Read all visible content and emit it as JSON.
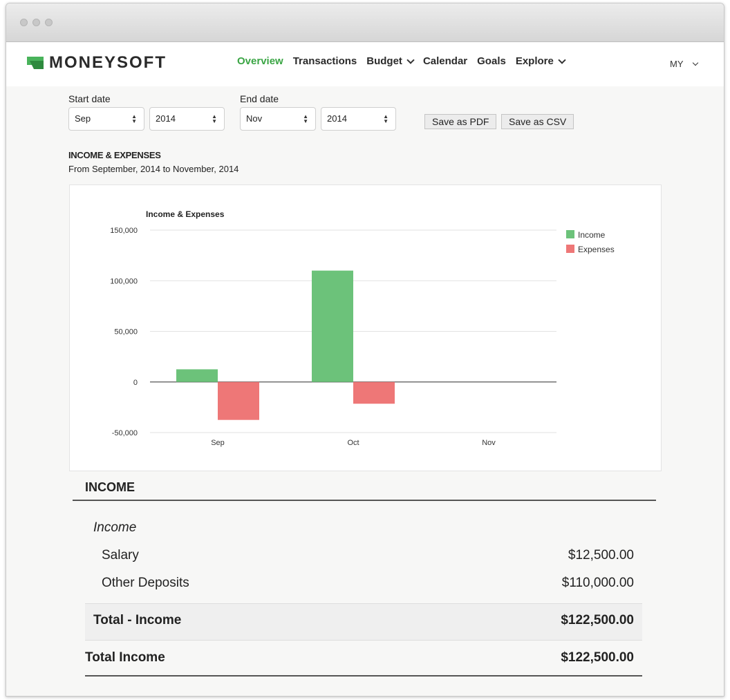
{
  "brand": {
    "name": "MONEYSOFT",
    "logo_color": "#49b35b"
  },
  "nav": {
    "items": [
      {
        "label": "Overview",
        "active": true,
        "dropdown": false
      },
      {
        "label": "Transactions",
        "active": false,
        "dropdown": false
      },
      {
        "label": "Budget",
        "active": false,
        "dropdown": true
      },
      {
        "label": "Calendar",
        "active": false,
        "dropdown": false
      },
      {
        "label": "Goals",
        "active": false,
        "dropdown": false
      },
      {
        "label": "Explore",
        "active": false,
        "dropdown": true
      }
    ],
    "user_label": "MY",
    "accent_color": "#3aa544"
  },
  "filters": {
    "start_label": "Start date",
    "end_label": "End date",
    "start_month": "Sep",
    "start_year": "2014",
    "end_month": "Nov",
    "end_year": "2014",
    "save_pdf": "Save as PDF",
    "save_csv": "Save as CSV"
  },
  "report": {
    "title": "INCOME & EXPENSES",
    "subtitle": "From September, 2014 to November, 2014"
  },
  "chart_data": {
    "type": "bar",
    "title": "Income & Expenses",
    "categories": [
      "Sep",
      "Oct",
      "Nov"
    ],
    "series": [
      {
        "name": "Income",
        "values": [
          12500,
          110000,
          0
        ],
        "color": "#6cc27a"
      },
      {
        "name": "Expenses",
        "values": [
          -37500,
          -21500,
          0
        ],
        "color": "#ee7777"
      }
    ],
    "ylim": [
      -50000,
      150000
    ],
    "yticks": [
      150000,
      100000,
      50000,
      0,
      -50000
    ],
    "ytick_labels": [
      "150,000",
      "100,000",
      "50,000",
      "0",
      "-50,000"
    ],
    "grid": true,
    "legend": "right",
    "xlabel": "",
    "ylabel": ""
  },
  "income_section": {
    "heading": "INCOME",
    "group_heading": "Income",
    "rows": [
      {
        "label": "Salary",
        "value": "$12,500.00"
      },
      {
        "label": "Other Deposits",
        "value": "$110,000.00"
      }
    ],
    "subtotal_label": "Total - Income",
    "subtotal_value": "$122,500.00",
    "total_label": "Total Income",
    "total_value": "$122,500.00"
  }
}
